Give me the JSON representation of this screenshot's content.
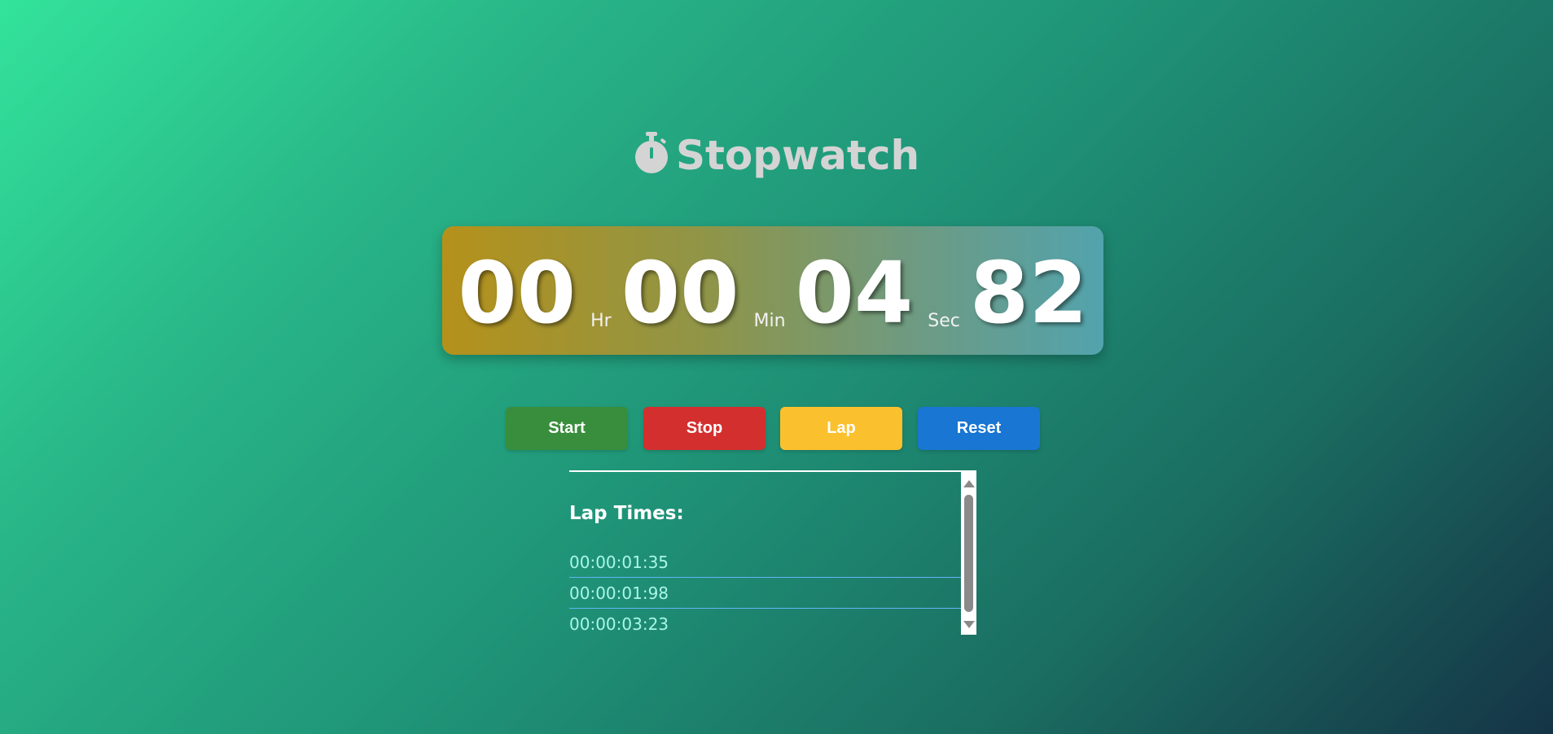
{
  "header": {
    "title": "Stopwatch",
    "icon": "stopwatch-icon"
  },
  "display": {
    "hours": "00",
    "hours_label": "Hr",
    "minutes": "00",
    "minutes_label": "Min",
    "seconds": "04",
    "seconds_label": "Sec",
    "centiseconds": "82"
  },
  "controls": {
    "start_label": "Start",
    "stop_label": "Stop",
    "lap_label": "Lap",
    "reset_label": "Reset"
  },
  "laps": {
    "heading": "Lap Times:",
    "items": [
      "00:00:01:35",
      "00:00:01:98",
      "00:00:03:23"
    ]
  },
  "colors": {
    "start": "#388e3c",
    "stop": "#d32f2f",
    "lap": "#fbc02d",
    "reset": "#1976d2"
  }
}
